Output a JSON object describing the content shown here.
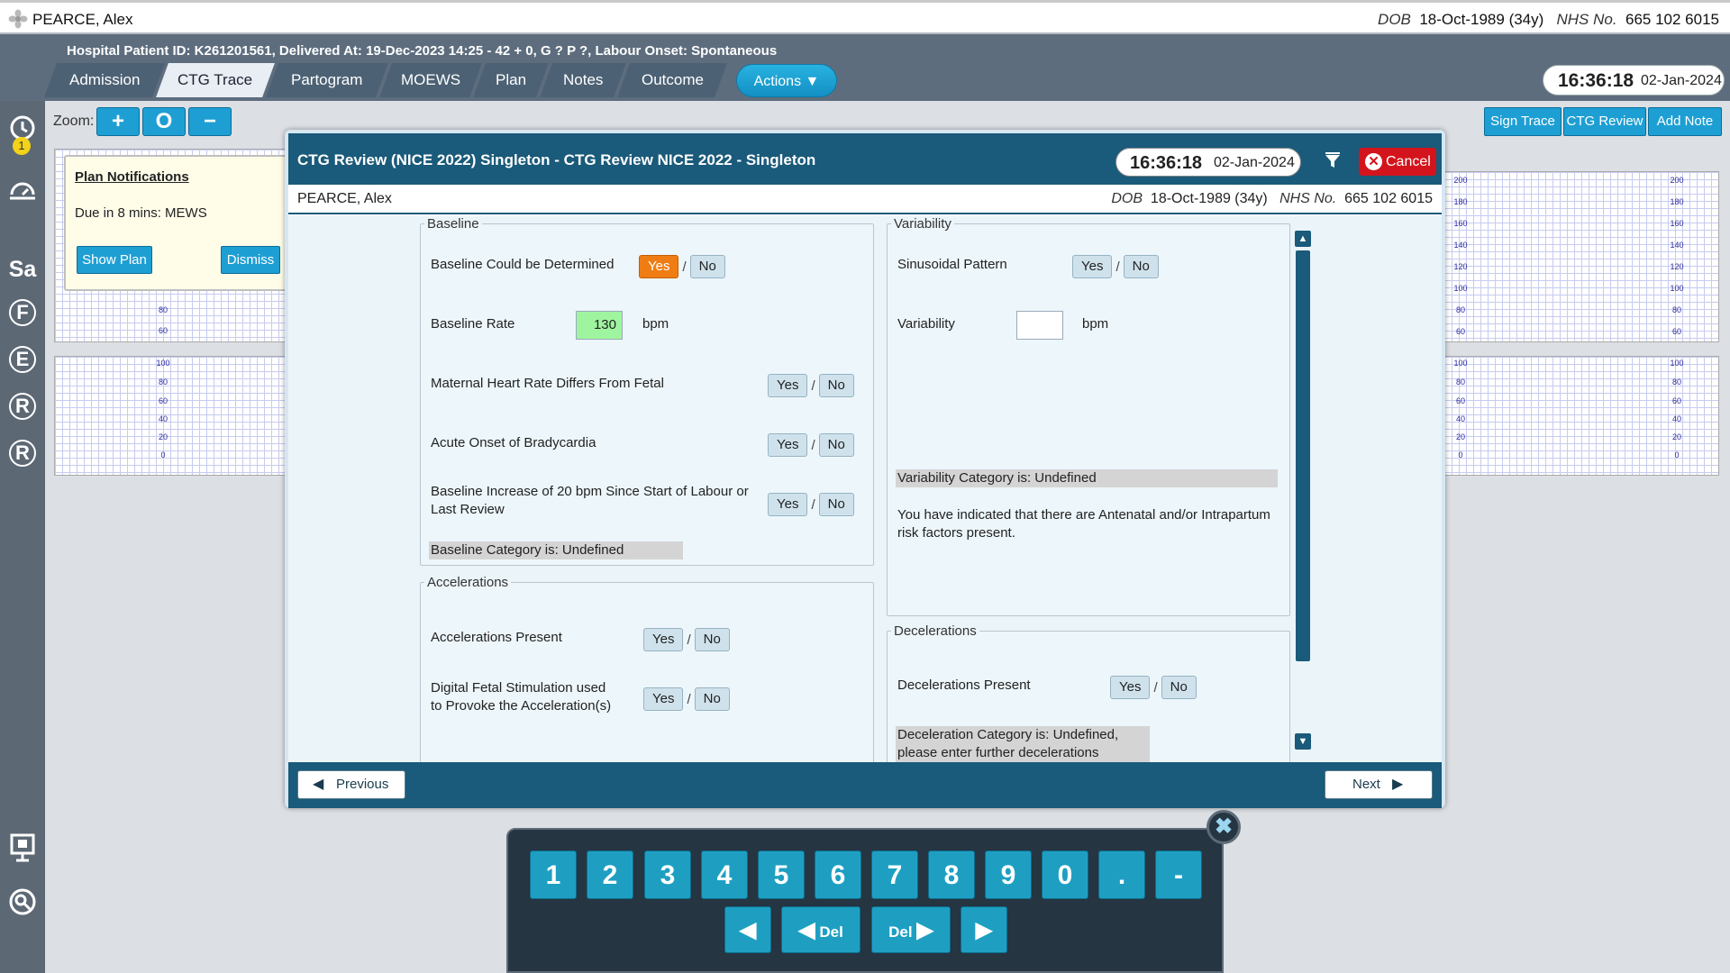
{
  "patient": {
    "name": "PEARCE, Alex",
    "dob_label": "DOB",
    "dob": "18-Oct-1989 (34y)",
    "nhs_label": "NHS No.",
    "nhs": "665 102 6015",
    "info_line": "Hospital Patient ID: K261201561, Delivered At: 19-Dec-2023 14:25 - 42 + 0, G ? P ?,   Labour Onset: Spontaneous"
  },
  "tabs": [
    {
      "label": "Admission"
    },
    {
      "label": "CTG Trace"
    },
    {
      "label": "Partogram"
    },
    {
      "label": "MOEWS"
    },
    {
      "label": "Plan"
    },
    {
      "label": "Notes"
    },
    {
      "label": "Outcome"
    }
  ],
  "actions_label": "Actions",
  "clock": {
    "time": "16:36:18",
    "date": "02-Jan-2024"
  },
  "sidebar": {
    "badge": "1",
    "letters": [
      "Sa",
      "F",
      "E",
      "R",
      "R"
    ]
  },
  "zoom": {
    "label": "Zoom:",
    "plus": "+",
    "reset": "O",
    "minus": "−"
  },
  "right_buttons": {
    "sign_trace": "Sign Trace",
    "ctg_review": "CTG Review",
    "add_note": "Add Note"
  },
  "ctg_scale_fhr": [
    "200",
    "180",
    "160",
    "140",
    "120",
    "100",
    "80",
    "60"
  ],
  "ctg_scale_toco": [
    "100",
    "80",
    "60",
    "40",
    "20",
    "0"
  ],
  "ctg_scale_left_fhr": [
    "100",
    "80",
    "60"
  ],
  "plan_notifications": {
    "heading": "Plan Notifications",
    "message": "Due in 8 mins: MEWS",
    "show_plan": "Show Plan",
    "dismiss": "Dismiss"
  },
  "modal": {
    "title": "CTG Review (NICE 2022) Singleton - CTG Review NICE 2022 - Singleton",
    "time": "16:36:18",
    "date": "02-Jan-2024",
    "cancel": "Cancel",
    "yes": "Yes",
    "no": "No",
    "slash": "/",
    "baseline": {
      "legend": "Baseline",
      "determined_label": "Baseline Could be Determined",
      "determined_value": "Yes",
      "rate_label": "Baseline Rate",
      "rate_value": "130",
      "rate_unit": "bpm",
      "maternal_label": "Maternal Heart Rate Differs From Fetal",
      "bradycardia_label": "Acute Onset of Bradycardia",
      "increase_label_1": "Baseline Increase of 20 bpm Since Start of Labour or",
      "increase_label_2": "Last Review",
      "category": "Baseline Category is: Undefined"
    },
    "variability": {
      "legend": "Variability",
      "sinusoidal_label": "Sinusoidal Pattern",
      "variability_label": "Variability",
      "variability_value": "",
      "unit": "bpm",
      "category": "Variability Category is: Undefined",
      "note_1": "You have indicated that there are Antenatal and/or Intrapartum",
      "note_2": "risk factors present."
    },
    "accelerations": {
      "legend": "Accelerations",
      "present_label": "Accelerations Present",
      "stim_label_1": "Digital Fetal Stimulation used",
      "stim_label_2": "to Provoke the Acceleration(s)"
    },
    "decelerations": {
      "legend": "Decelerations",
      "present_label": "Decelerations Present",
      "category_1": "Deceleration Category is: Undefined,",
      "category_2": "please enter further decelerations"
    },
    "previous": "Previous",
    "next": "Next"
  },
  "keypad": {
    "keys": [
      "1",
      "2",
      "3",
      "4",
      "5",
      "6",
      "7",
      "8",
      "9",
      "0",
      ".",
      "-"
    ],
    "left": "◀",
    "del_left": "Del",
    "del_right": "Del",
    "right": "▶",
    "close": "✖"
  }
}
